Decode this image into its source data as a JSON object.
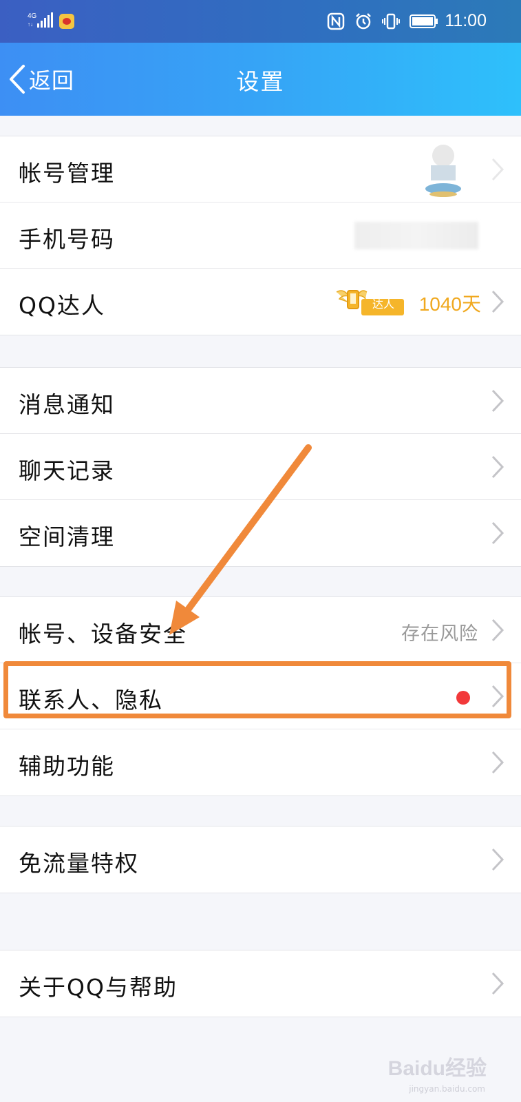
{
  "status_bar": {
    "network": "4G",
    "time": "11:00",
    "icons": [
      "signal-icon",
      "weibo-icon",
      "nfc-icon",
      "alarm-icon",
      "vibrate-icon",
      "battery-icon"
    ]
  },
  "nav": {
    "back_label": "返回",
    "title": "设置"
  },
  "groups": [
    {
      "rows": [
        {
          "label": "帐号管理"
        },
        {
          "label": "手机号码"
        },
        {
          "label": "QQ达人",
          "badge_text": "达人",
          "value": "1040天"
        }
      ]
    },
    {
      "rows": [
        {
          "label": "消息通知"
        },
        {
          "label": "聊天记录"
        },
        {
          "label": "空间清理"
        }
      ]
    },
    {
      "rows": [
        {
          "label": "帐号、设备安全",
          "value": "存在风险"
        },
        {
          "label": "联系人、隐私"
        },
        {
          "label": "辅助功能"
        }
      ]
    },
    {
      "rows": [
        {
          "label": "免流量特权"
        }
      ]
    },
    {
      "rows": [
        {
          "label": "关于QQ与帮助"
        }
      ]
    }
  ],
  "watermark": {
    "brand": "Baidu经验",
    "url": "jingyan.baidu.com"
  },
  "colors": {
    "accent_orange": "#f0893a",
    "daren_gold": "#f0a81e",
    "red_dot": "#f2393a"
  }
}
